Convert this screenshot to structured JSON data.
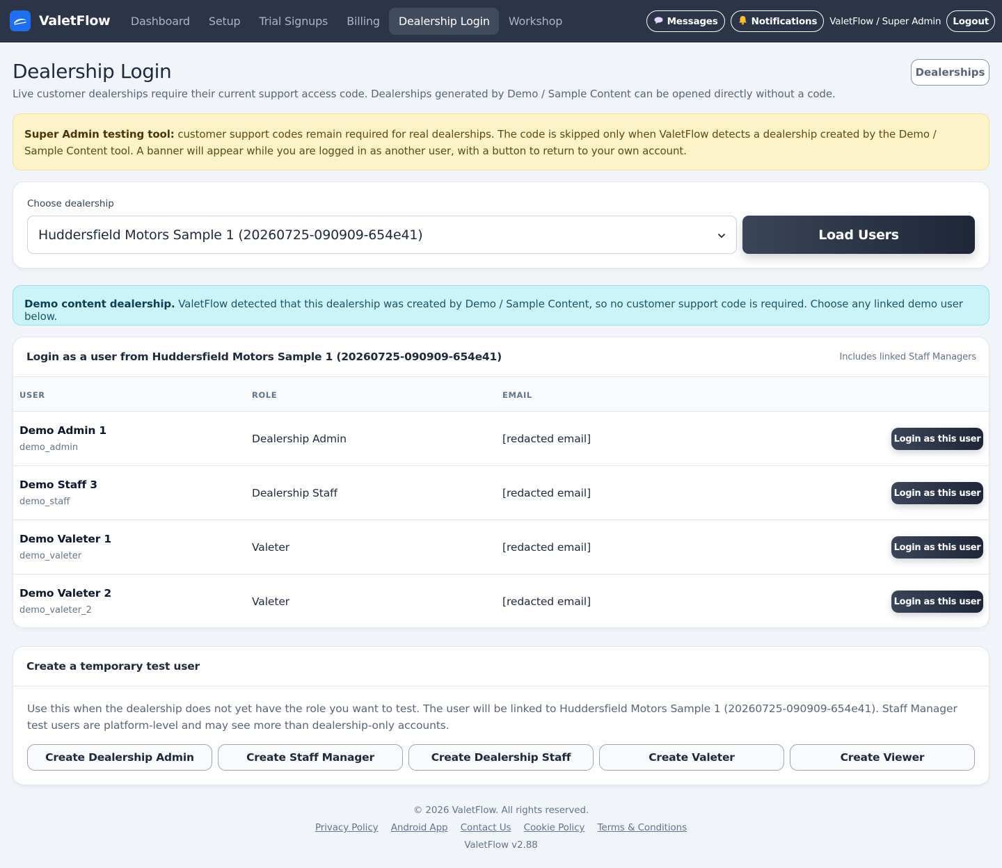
{
  "nav": {
    "brand": "ValetFlow",
    "links": [
      {
        "label": "Dashboard",
        "active": false
      },
      {
        "label": "Setup",
        "active": false
      },
      {
        "label": "Trial Signups",
        "active": false
      },
      {
        "label": "Billing",
        "active": false
      },
      {
        "label": "Dealership Login",
        "active": true
      },
      {
        "label": "Workshop",
        "active": false
      }
    ],
    "messages_label": "Messages",
    "messages_icon": "speech-bubble-icon",
    "notifications_label": "Notifications",
    "notifications_icon": "bell-icon",
    "user_label": "ValetFlow / Super Admin",
    "logout_label": "Logout"
  },
  "header": {
    "title": "Dealership Login",
    "subtitle": "Live customer dealerships require their current support access code. Dealerships generated by Demo / Sample Content can be opened directly without a code.",
    "dealerships_button": "Dealerships"
  },
  "warning": {
    "bold": "Super Admin testing tool:",
    "text": " customer support codes remain required for real dealerships. The code is skipped only when ValetFlow detects a dealership created by the Demo / Sample Content tool. A banner will appear while you are logged in as another user, with a button to return to your own account."
  },
  "choose": {
    "label": "Choose dealership",
    "selected": "Huddersfield Motors Sample 1 (20260725-090909-654e41)",
    "load_button": "Load Users"
  },
  "info": {
    "bold": "Demo content dealership.",
    "text": " ValetFlow detected that this dealership was created by Demo / Sample Content, so no customer support code is required. Choose any linked demo user below."
  },
  "users": {
    "title": "Login as a user from Huddersfield Motors Sample 1 (20260725-090909-654e41)",
    "note": "Includes linked Staff Managers",
    "columns": [
      "USER",
      "ROLE",
      "EMAIL"
    ],
    "login_label": "Login as this user",
    "rows": [
      {
        "name": "Demo Admin 1",
        "handle": "demo_admin",
        "role": "Dealership Admin",
        "email": "[redacted email]"
      },
      {
        "name": "Demo Staff 3",
        "handle": "demo_staff",
        "role": "Dealership Staff",
        "email": "[redacted email]"
      },
      {
        "name": "Demo Valeter 1",
        "handle": "demo_valeter",
        "role": "Valeter",
        "email": "[redacted email]"
      },
      {
        "name": "Demo Valeter 2",
        "handle": "demo_valeter_2",
        "role": "Valeter",
        "email": "[redacted email]"
      }
    ]
  },
  "create": {
    "title": "Create a temporary test user",
    "text": "Use this when the dealership does not yet have the role you want to test. The user will be linked to Huddersfield Motors Sample 1 (20260725-090909-654e41). Staff Manager test users are platform-level and may see more than dealership-only accounts.",
    "buttons": [
      "Create Dealership Admin",
      "Create Staff Manager",
      "Create Dealership Staff",
      "Create Valeter",
      "Create Viewer"
    ]
  },
  "footer": {
    "copyright": "© 2026 ValetFlow. All rights reserved.",
    "links": [
      "Privacy Policy",
      "Android App",
      "Contact Us",
      "Cookie Policy",
      "Terms & Conditions"
    ],
    "version": "ValetFlow v2.88"
  },
  "colors": {
    "nav_bg": "#2c3547",
    "brand_blue": "#1d6ff2",
    "warning_bg": "#fdf3c8",
    "info_bg": "#cdf3fa",
    "button_dark": "#1e2638"
  }
}
